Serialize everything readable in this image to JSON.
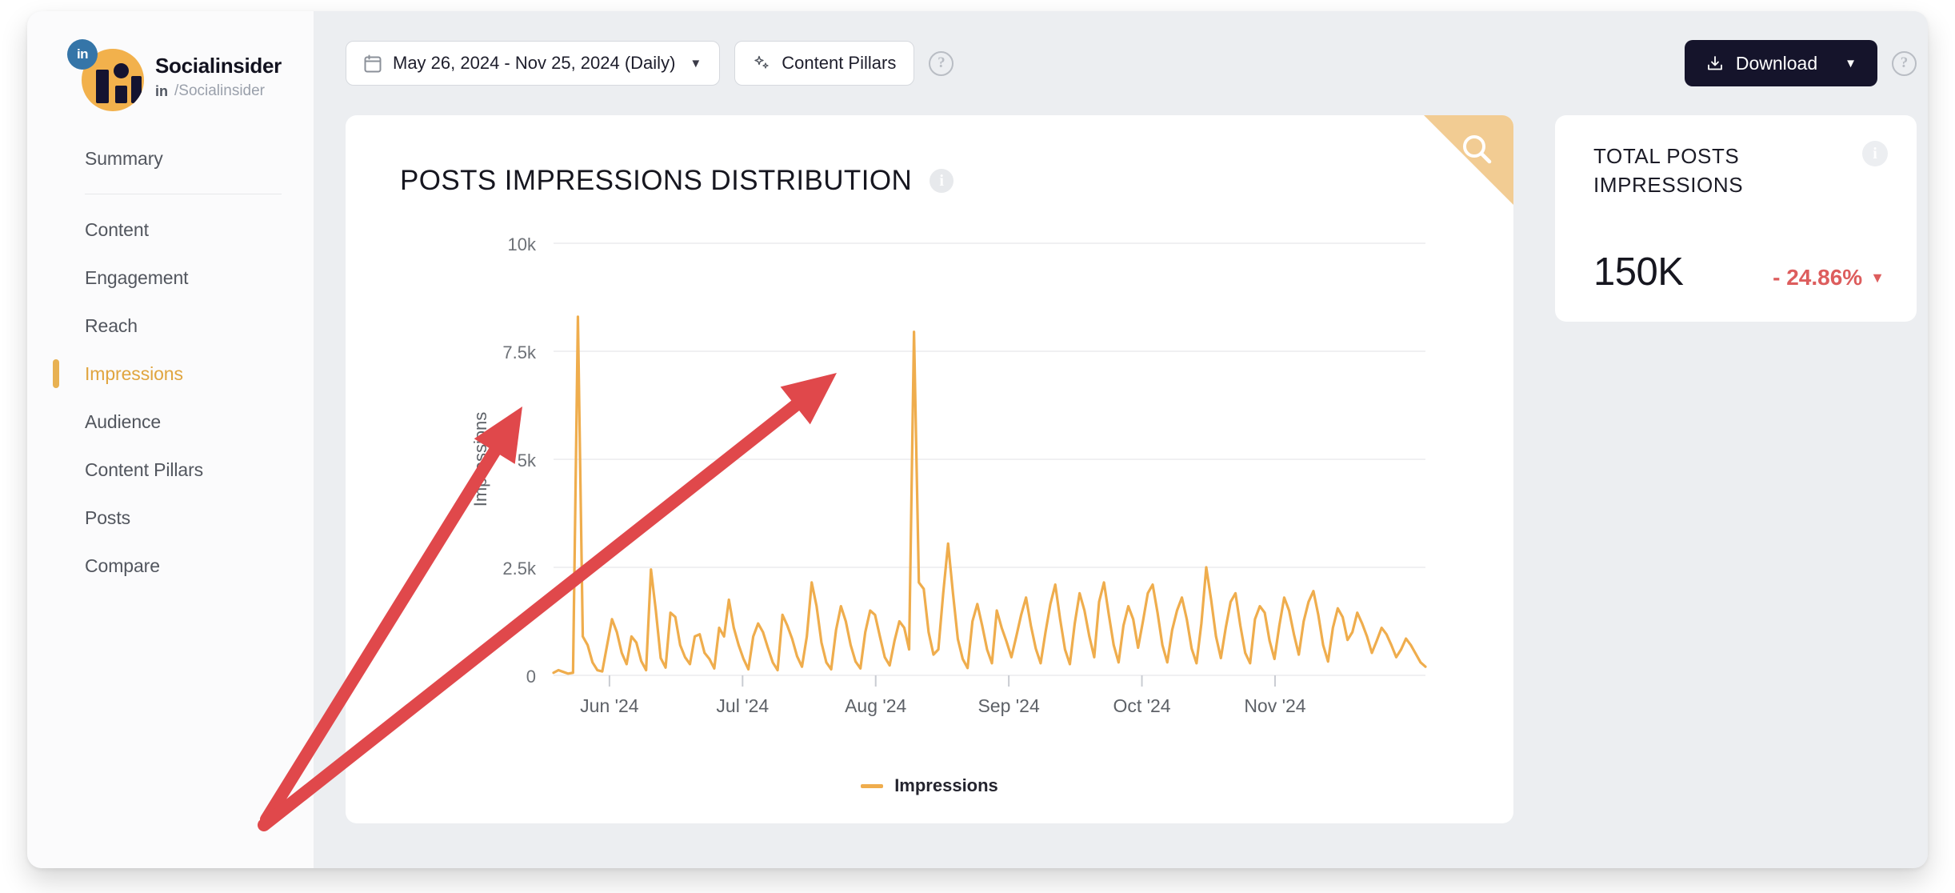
{
  "sidebar": {
    "profile": {
      "name": "Socialinsider",
      "network_badge": "in",
      "handle_prefix": "in",
      "handle": "/Socialinsider",
      "avatar_icon": "socialinsider-avatar"
    },
    "items": [
      {
        "label": "Summary",
        "active": false
      },
      {
        "label": "Content",
        "active": false
      },
      {
        "label": "Engagement",
        "active": false
      },
      {
        "label": "Reach",
        "active": false
      },
      {
        "label": "Impressions",
        "active": true
      },
      {
        "label": "Audience",
        "active": false
      },
      {
        "label": "Content Pillars",
        "active": false
      },
      {
        "label": "Posts",
        "active": false
      },
      {
        "label": "Compare",
        "active": false
      }
    ]
  },
  "toolbar": {
    "date_range": "May 26, 2024 - Nov 25, 2024 (Daily)",
    "date_caret": "▼",
    "content_pillars": "Content Pillars",
    "help_label": "?",
    "download": "Download",
    "download_caret": "▼"
  },
  "chart_card": {
    "title": "POSTS IMPRESSIONS DISTRIBUTION",
    "info_label": "i",
    "corner_icon": "search-icon",
    "legend_label": "Impressions"
  },
  "stat_card": {
    "title": "TOTAL POSTS IMPRESSIONS",
    "info_label": "i",
    "value": "150K",
    "delta": "- 24.86%",
    "delta_caret": "▼",
    "delta_color": "#dd5d5d"
  },
  "colors": {
    "accent_orange": "#efad4d",
    "sidebar_active": "#e0a53f",
    "window_bg": "#eceef1",
    "download_bg": "#15142b",
    "annotation_red": "#e0484b",
    "corner_tan": "#f2cc93"
  },
  "annotations": [
    {
      "name": "arrow-upper",
      "from": [
        333,
        1024
      ],
      "to": [
        653,
        508
      ]
    },
    {
      "name": "arrow-lower",
      "from": [
        330,
        1031
      ],
      "to": [
        1046,
        466
      ]
    }
  ],
  "chart_data": {
    "type": "line",
    "title": "POSTS IMPRESSIONS DISTRIBUTION",
    "xlabel": "",
    "ylabel": "Impressions",
    "ylim": [
      0,
      10000
    ],
    "yticks": [
      0,
      2500,
      5000,
      7500,
      10000
    ],
    "ytick_labels": [
      "0",
      "2.5k",
      "5k",
      "7.5k",
      "10k"
    ],
    "xtick_labels": [
      "Jun '24",
      "Jul '24",
      "Aug '24",
      "Sep '24",
      "Oct '24",
      "Nov '24"
    ],
    "grid": true,
    "legend_position": "bottom",
    "series": [
      {
        "name": "Impressions",
        "color": "#efad4d",
        "x_start": "2024-05-26",
        "x_end": "2024-11-25",
        "interval": "daily",
        "values": [
          60,
          120,
          80,
          40,
          60,
          8300,
          900,
          700,
          300,
          120,
          90,
          700,
          1300,
          1000,
          520,
          260,
          900,
          760,
          330,
          120,
          2450,
          1500,
          400,
          180,
          1450,
          1350,
          700,
          420,
          260,
          900,
          950,
          520,
          380,
          160,
          1100,
          900,
          1750,
          1100,
          700,
          380,
          140,
          900,
          1200,
          1000,
          640,
          300,
          120,
          1400,
          1150,
          840,
          440,
          200,
          900,
          2150,
          1600,
          760,
          300,
          140,
          1050,
          1600,
          1250,
          700,
          320,
          160,
          1000,
          1500,
          1400,
          900,
          420,
          230,
          800,
          1250,
          1100,
          600,
          7950,
          2150,
          2000,
          1000,
          480,
          600,
          1900,
          3050,
          1900,
          840,
          380,
          170,
          1250,
          1650,
          1150,
          600,
          280,
          1500,
          1100,
          780,
          420,
          900,
          1400,
          1800,
          1150,
          620,
          280,
          1000,
          1650,
          2100,
          1300,
          600,
          260,
          1200,
          1900,
          1500,
          900,
          420,
          1700,
          2150,
          1400,
          700,
          300,
          1150,
          1600,
          1300,
          640,
          1250,
          1900,
          2100,
          1450,
          700,
          300,
          1050,
          1500,
          1800,
          1300,
          620,
          280,
          1200,
          2500,
          1750,
          900,
          400,
          1100,
          1700,
          1900,
          1150,
          520,
          280,
          1300,
          1600,
          1450,
          800,
          380,
          1150,
          1800,
          1500,
          950,
          480,
          1250,
          1700,
          1950,
          1400,
          700,
          320,
          1100,
          1550,
          1350,
          820,
          1000,
          1450,
          1200,
          900,
          520,
          800,
          1100,
          950,
          700,
          420,
          600,
          850,
          700,
          500,
          300,
          200
        ]
      }
    ]
  }
}
